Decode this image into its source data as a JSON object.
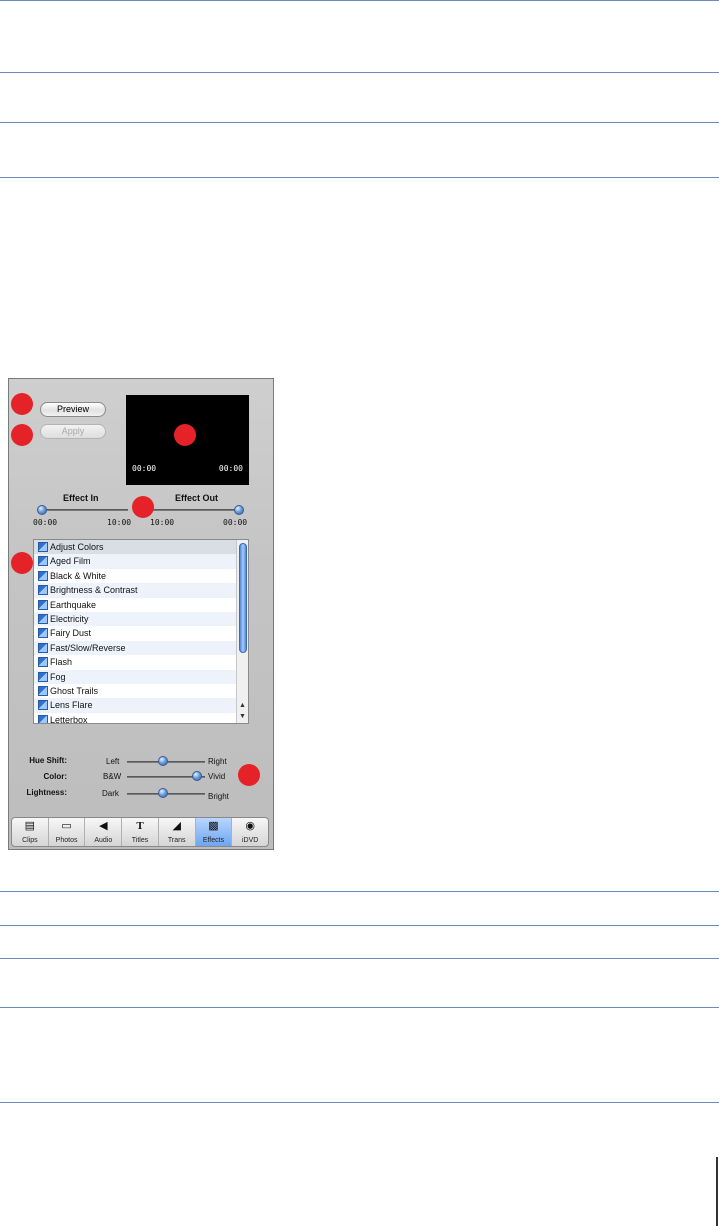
{
  "panel": {
    "buttons": {
      "preview_label": "Preview",
      "apply_label": "Apply"
    },
    "viewer": {
      "timecode_left": "00:00",
      "timecode_right": "00:00"
    },
    "effect_in": {
      "label": "Effect In",
      "start": "00:00",
      "end": "10:00"
    },
    "effect_out": {
      "label": "Effect Out",
      "start": "10:00",
      "end": "00:00"
    },
    "effects_list": [
      "Adjust Colors",
      "Aged Film",
      "Black & White",
      "Brightness & Contrast",
      "Earthquake",
      "Electricity",
      "Fairy Dust",
      "Fast/Slow/Reverse",
      "Flash",
      "Fog",
      "Ghost Trails",
      "Lens Flare",
      "Letterbox"
    ],
    "controls": {
      "hue_shift": {
        "label": "Hue Shift:",
        "min": "Left",
        "max": "Right",
        "value": 0.45
      },
      "color": {
        "label": "Color:",
        "min": "B&W",
        "max": "Vivid",
        "value": 0.95
      },
      "lightness": {
        "label": "Lightness:",
        "min": "Dark",
        "max": "Bright",
        "value": 0.45
      }
    },
    "tabs": [
      {
        "label": "Clips",
        "icon": "clips-icon"
      },
      {
        "label": "Photos",
        "icon": "photos-icon"
      },
      {
        "label": "Audio",
        "icon": "audio-icon"
      },
      {
        "label": "Titles",
        "icon": "titles-icon"
      },
      {
        "label": "Trans",
        "icon": "transitions-icon"
      },
      {
        "label": "Effects",
        "icon": "effects-icon",
        "active": true
      },
      {
        "label": "iDVD",
        "icon": "idvd-icon"
      }
    ]
  },
  "colors": {
    "callout": "#e52227",
    "rule": "#6d8bb8",
    "accent": "#6ea6ee"
  }
}
